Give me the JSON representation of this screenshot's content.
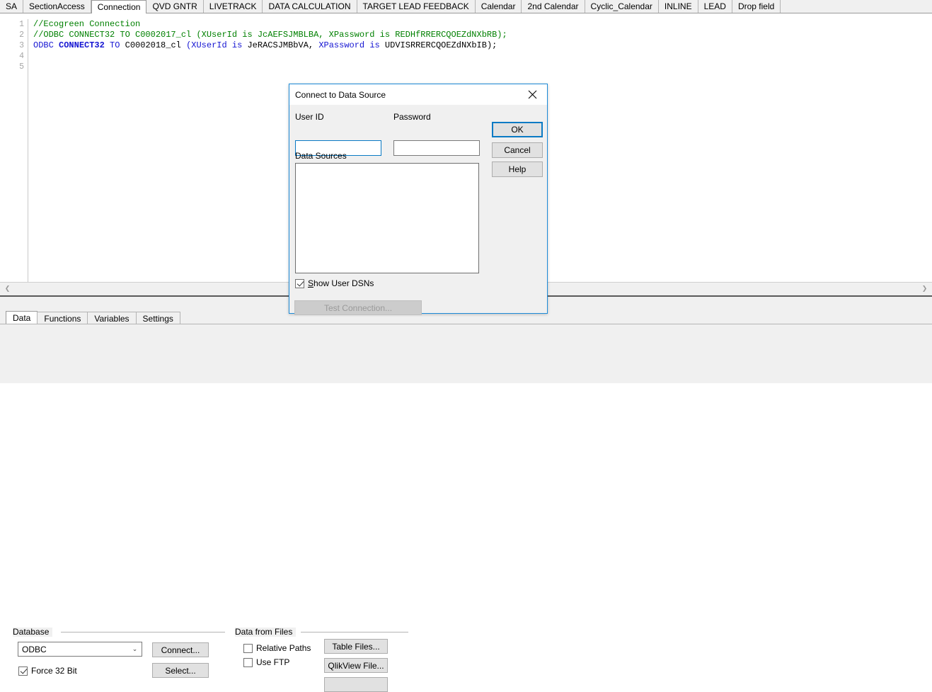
{
  "script_tabs": [
    {
      "label": "SA",
      "active": false
    },
    {
      "label": "SectionAccess",
      "active": false
    },
    {
      "label": "Connection",
      "active": true
    },
    {
      "label": "QVD GNTR",
      "active": false
    },
    {
      "label": "LIVETRACK",
      "active": false
    },
    {
      "label": "DATA CALCULATION",
      "active": false
    },
    {
      "label": "TARGET  LEAD FEEDBACK",
      "active": false
    },
    {
      "label": "Calendar",
      "active": false
    },
    {
      "label": "2nd Calendar",
      "active": false
    },
    {
      "label": "Cyclic_Calendar",
      "active": false
    },
    {
      "label": "INLINE",
      "active": false
    },
    {
      "label": "LEAD",
      "active": false
    },
    {
      "label": "Drop field",
      "active": false
    }
  ],
  "editor": {
    "line_numbers": [
      "1",
      "2",
      "3",
      "4",
      "5"
    ],
    "lines": [
      {
        "n": "1",
        "tokens": [
          {
            "t": "//Ecogreen Connection",
            "c": "comment"
          }
        ]
      },
      {
        "n": "2",
        "tokens": [
          {
            "t": "//ODBC CONNECT32 TO C0002017_cl (XUserId is JcAEFSJMBLBA, XPassword is REDHfRRERCQOEZdNXbRB);",
            "c": "comment"
          }
        ]
      },
      {
        "n": "3",
        "tokens": [
          {
            "t": "ODBC ",
            "c": "kw"
          },
          {
            "t": "CONNECT32",
            "c": "kw-b"
          },
          {
            "t": " TO ",
            "c": "kw"
          },
          {
            "t": "C0002018_cl ",
            "c": "plain"
          },
          {
            "t": "(XUserId is",
            "c": "kw"
          },
          {
            "t": " JeRACSJMBbVA, ",
            "c": "plain"
          },
          {
            "t": "XPassword is",
            "c": "kw"
          },
          {
            "t": " UDVISRRERCQOEZdNXbIB);",
            "c": "plain"
          }
        ]
      },
      {
        "n": "4",
        "tokens": []
      },
      {
        "n": "5",
        "tokens": []
      }
    ]
  },
  "hscroll": {
    "left_arrow": "❮",
    "right_arrow": "❯"
  },
  "panel": {
    "tabs": [
      {
        "label": "Data",
        "active": true
      },
      {
        "label": "Functions",
        "active": false
      },
      {
        "label": "Variables",
        "active": false
      },
      {
        "label": "Settings",
        "active": false
      }
    ],
    "database_group": {
      "label": "Database",
      "combo_value": "ODBC",
      "combo_arrow": "⌄",
      "connect_button": "Connect...",
      "select_button": "Select...",
      "force32_label": "Force 32 Bit",
      "force32_checked": true
    },
    "files_group": {
      "label": "Data from Files",
      "relative_paths_label": "Relative Paths",
      "relative_paths_checked": false,
      "use_ftp_label": "Use FTP",
      "use_ftp_checked": false,
      "table_files_button": "Table Files...",
      "qlikview_file_button": "QlikView File...",
      "third_button": ""
    }
  },
  "dialog": {
    "title": "Connect to Data Source",
    "close_icon": "✕",
    "user_id_label": "User ID",
    "user_id_value": "",
    "password_label": "Password",
    "password_value": "",
    "data_sources_label": "Data Sources",
    "data_sources_items": [],
    "ok_button": "OK",
    "cancel_button": "Cancel",
    "help_button": "Help",
    "show_user_dsns_label_prefix": "S",
    "show_user_dsns_label_rest": "how User DSNs",
    "show_user_dsns_checked": true,
    "test_connection_button": "Test Connection...",
    "test_connection_enabled": false
  },
  "colors": {
    "accent_blue": "#0a7ac4",
    "dialog_border": "#1d8bd8",
    "comment_green": "#008000",
    "keyword_blue": "#1414d2",
    "panel_grey": "#f0f0f0",
    "button_grey": "#e1e1e1",
    "disabled_text": "#9a9a9a"
  }
}
